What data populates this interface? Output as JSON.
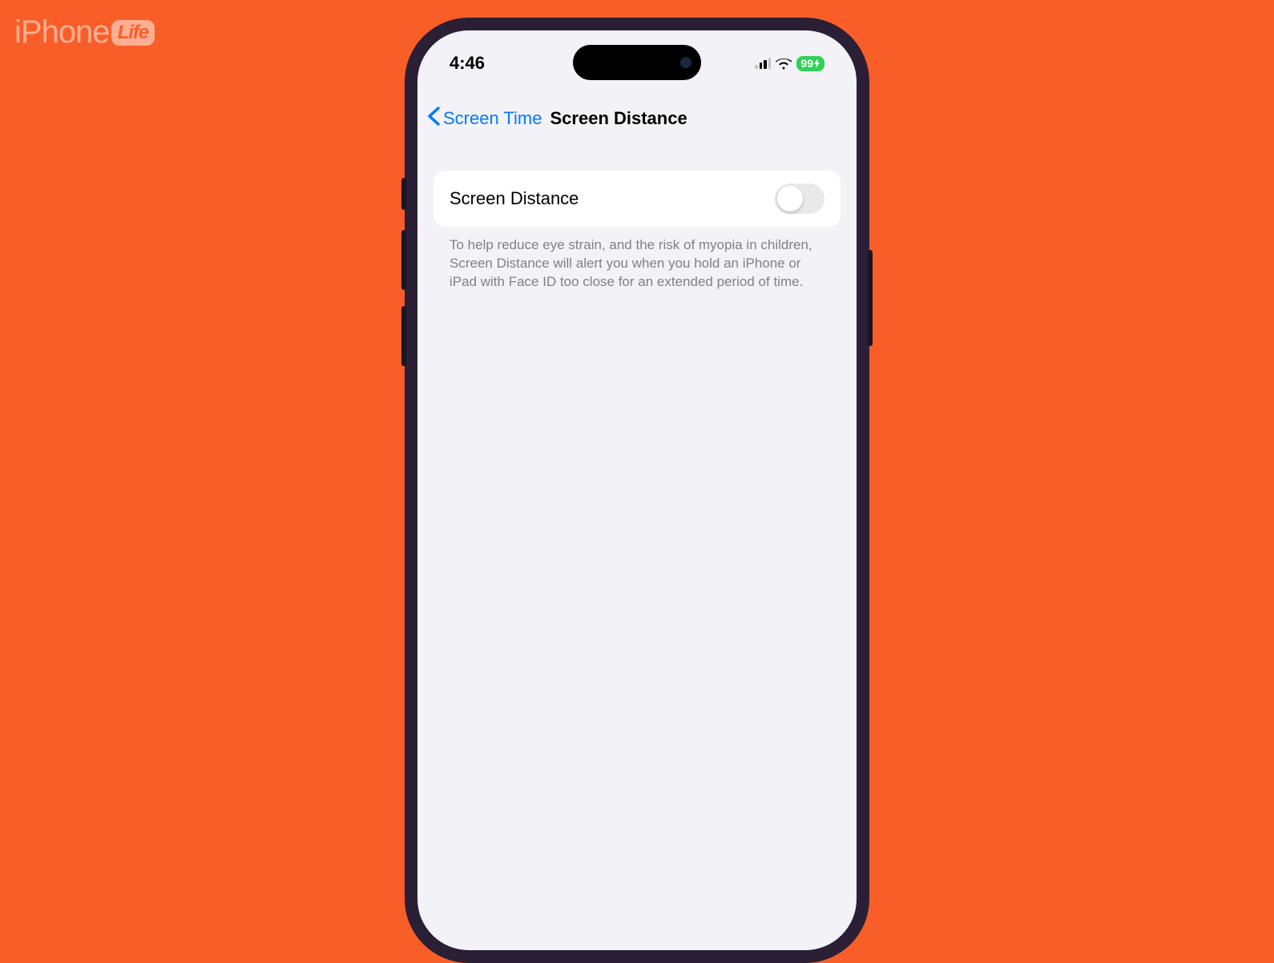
{
  "watermark": {
    "brand": "iPhone",
    "badge": "Life"
  },
  "status": {
    "time": "4:46",
    "battery": "99"
  },
  "nav": {
    "back": "Screen Time",
    "title": "Screen Distance"
  },
  "setting": {
    "label": "Screen Distance",
    "toggle": false,
    "description": "To help reduce eye strain, and the risk of myopia in children, Screen Distance will alert you when you hold an iPhone or iPad with Face ID too close for an extended period of time."
  }
}
